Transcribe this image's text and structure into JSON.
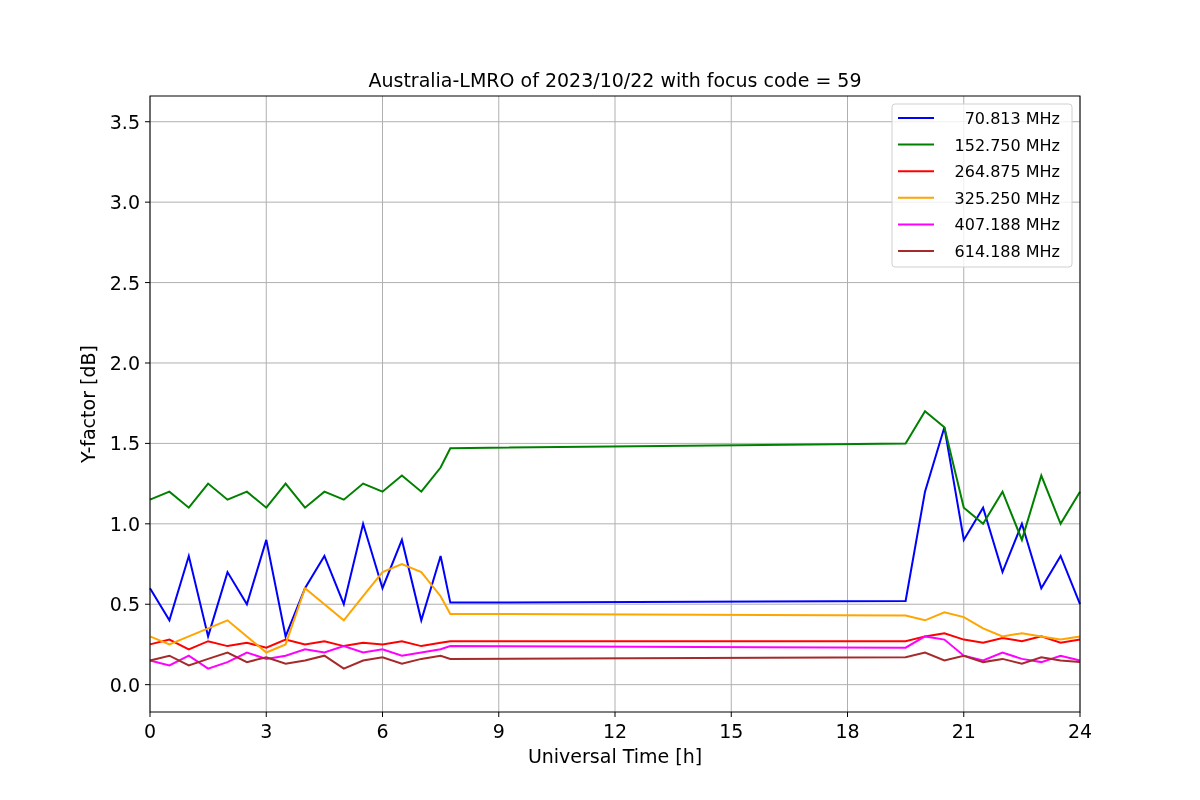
{
  "chart_data": {
    "type": "line",
    "title": "Australia-LMRO of 2023/10/22 with focus code = 59",
    "xlabel": "Universal Time [h]",
    "ylabel": "Y-factor [dB]",
    "x": [
      0,
      0.5,
      1,
      1.5,
      2,
      2.5,
      3,
      3.5,
      4,
      4.5,
      5,
      5.5,
      6,
      6.5,
      7,
      7.5,
      7.75,
      19.5,
      20,
      20.5,
      21,
      21.5,
      22,
      22.5,
      23,
      23.5,
      24
    ],
    "grid": true,
    "legend": true,
    "xlim": [
      0,
      24
    ],
    "ylim": [
      -0.17,
      3.66
    ],
    "xticks": [
      0,
      3,
      6,
      9,
      12,
      15,
      18,
      21,
      24
    ],
    "yticks": [
      {
        "value": 0,
        "label": "0.0"
      },
      {
        "value": 0.5,
        "label": "0.5"
      },
      {
        "value": 1,
        "label": "1.0"
      },
      {
        "value": 1.5,
        "label": "1.5"
      },
      {
        "value": 2,
        "label": "2.0"
      },
      {
        "value": 2.5,
        "label": "2.5"
      },
      {
        "value": 3,
        "label": "3.0"
      },
      {
        "value": 3.5,
        "label": "3.5"
      }
    ],
    "series": [
      {
        "name": "70.813 MHz",
        "color": "#0000ff",
        "values": [
          0.6,
          0.4,
          0.8,
          0.3,
          0.7,
          0.5,
          0.9,
          0.3,
          0.6,
          0.8,
          0.5,
          1.0,
          0.6,
          0.9,
          0.4,
          0.8,
          0.51,
          0.52,
          1.2,
          1.6,
          0.9,
          1.1,
          0.7,
          1.0,
          0.6,
          0.8,
          0.5
        ]
      },
      {
        "name": "152.750 MHz",
        "color": "#008000",
        "values": [
          1.15,
          1.2,
          1.1,
          1.25,
          1.15,
          1.2,
          1.1,
          1.25,
          1.1,
          1.2,
          1.15,
          1.25,
          1.2,
          1.3,
          1.2,
          1.35,
          1.47,
          1.5,
          1.7,
          1.6,
          1.1,
          1.0,
          1.2,
          0.9,
          1.3,
          1.0,
          1.2
        ]
      },
      {
        "name": "264.875 MHz",
        "color": "#ff0000",
        "values": [
          0.25,
          0.28,
          0.22,
          0.27,
          0.24,
          0.26,
          0.23,
          0.28,
          0.25,
          0.27,
          0.24,
          0.26,
          0.25,
          0.27,
          0.24,
          0.26,
          0.27,
          0.27,
          0.3,
          0.32,
          0.28,
          0.26,
          0.29,
          0.27,
          0.3,
          0.26,
          0.28
        ]
      },
      {
        "name": "325.250 MHz",
        "color": "#ffa500",
        "values": [
          0.3,
          0.25,
          0.3,
          0.35,
          0.4,
          0.3,
          0.2,
          0.25,
          0.6,
          0.5,
          0.4,
          0.55,
          0.7,
          0.75,
          0.7,
          0.55,
          0.44,
          0.43,
          0.4,
          0.45,
          0.42,
          0.35,
          0.3,
          0.32,
          0.3,
          0.28,
          0.3
        ]
      },
      {
        "name": "407.188 MHz",
        "color": "#ff00ff",
        "values": [
          0.15,
          0.12,
          0.18,
          0.1,
          0.14,
          0.2,
          0.16,
          0.18,
          0.22,
          0.2,
          0.24,
          0.2,
          0.22,
          0.18,
          0.2,
          0.22,
          0.24,
          0.23,
          0.3,
          0.28,
          0.18,
          0.15,
          0.2,
          0.16,
          0.14,
          0.18,
          0.15
        ]
      },
      {
        "name": "614.188 MHz",
        "color": "#a52a2a",
        "values": [
          0.15,
          0.18,
          0.12,
          0.16,
          0.2,
          0.14,
          0.17,
          0.13,
          0.15,
          0.18,
          0.1,
          0.15,
          0.17,
          0.13,
          0.16,
          0.18,
          0.16,
          0.17,
          0.2,
          0.15,
          0.18,
          0.14,
          0.16,
          0.13,
          0.17,
          0.15,
          0.14
        ]
      }
    ]
  }
}
